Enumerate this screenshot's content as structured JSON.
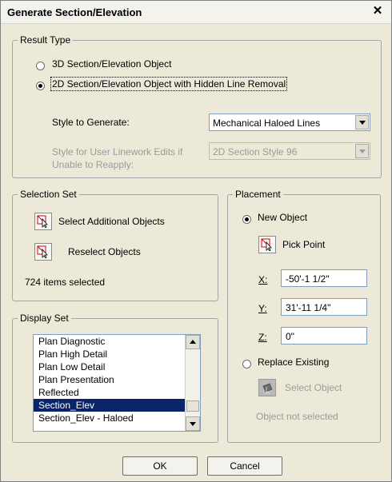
{
  "dialog": {
    "title": "Generate Section/Elevation"
  },
  "result_type": {
    "legend": "Result Type",
    "option_3d": "3D Section/Elevation Object",
    "option_2d": "2D Section/Elevation Object with Hidden Line Removal",
    "selected": "2d",
    "style_label": "Style to Generate:",
    "style_value": "Mechanical Haloed Lines",
    "style_user_label_1": "Style for User Linework Edits if",
    "style_user_label_2": "Unable to Reapply:",
    "style_user_value": "2D Section Style 96"
  },
  "selection_set": {
    "legend": "Selection Set",
    "select_additional": "Select Additional Objects",
    "reselect": "Reselect Objects",
    "count_text": "724 items selected"
  },
  "display_set": {
    "legend": "Display Set",
    "items": [
      "Plan Diagnostic",
      "Plan High Detail",
      "Plan Low Detail",
      "Plan Presentation",
      "Reflected",
      "Section_Elev",
      "Section_Elev - Haloed"
    ],
    "selected": "Section_Elev"
  },
  "placement": {
    "legend": "Placement",
    "new_object": "New Object",
    "pick_point": "Pick Point",
    "x_label": "X:",
    "x_value": "-50'-1 1/2\"",
    "y_label": "Y:",
    "y_value": "31'-11 1/4\"",
    "z_label": "Z:",
    "z_value": "0\"",
    "replace_existing": "Replace Existing",
    "select_object": "Select Object",
    "status": "Object not selected",
    "selected_option": "new_object"
  },
  "buttons": {
    "ok": "OK",
    "cancel": "Cancel"
  },
  "colors": {
    "selection": "#0a246a",
    "dialog_bg": "#ece9d8"
  }
}
